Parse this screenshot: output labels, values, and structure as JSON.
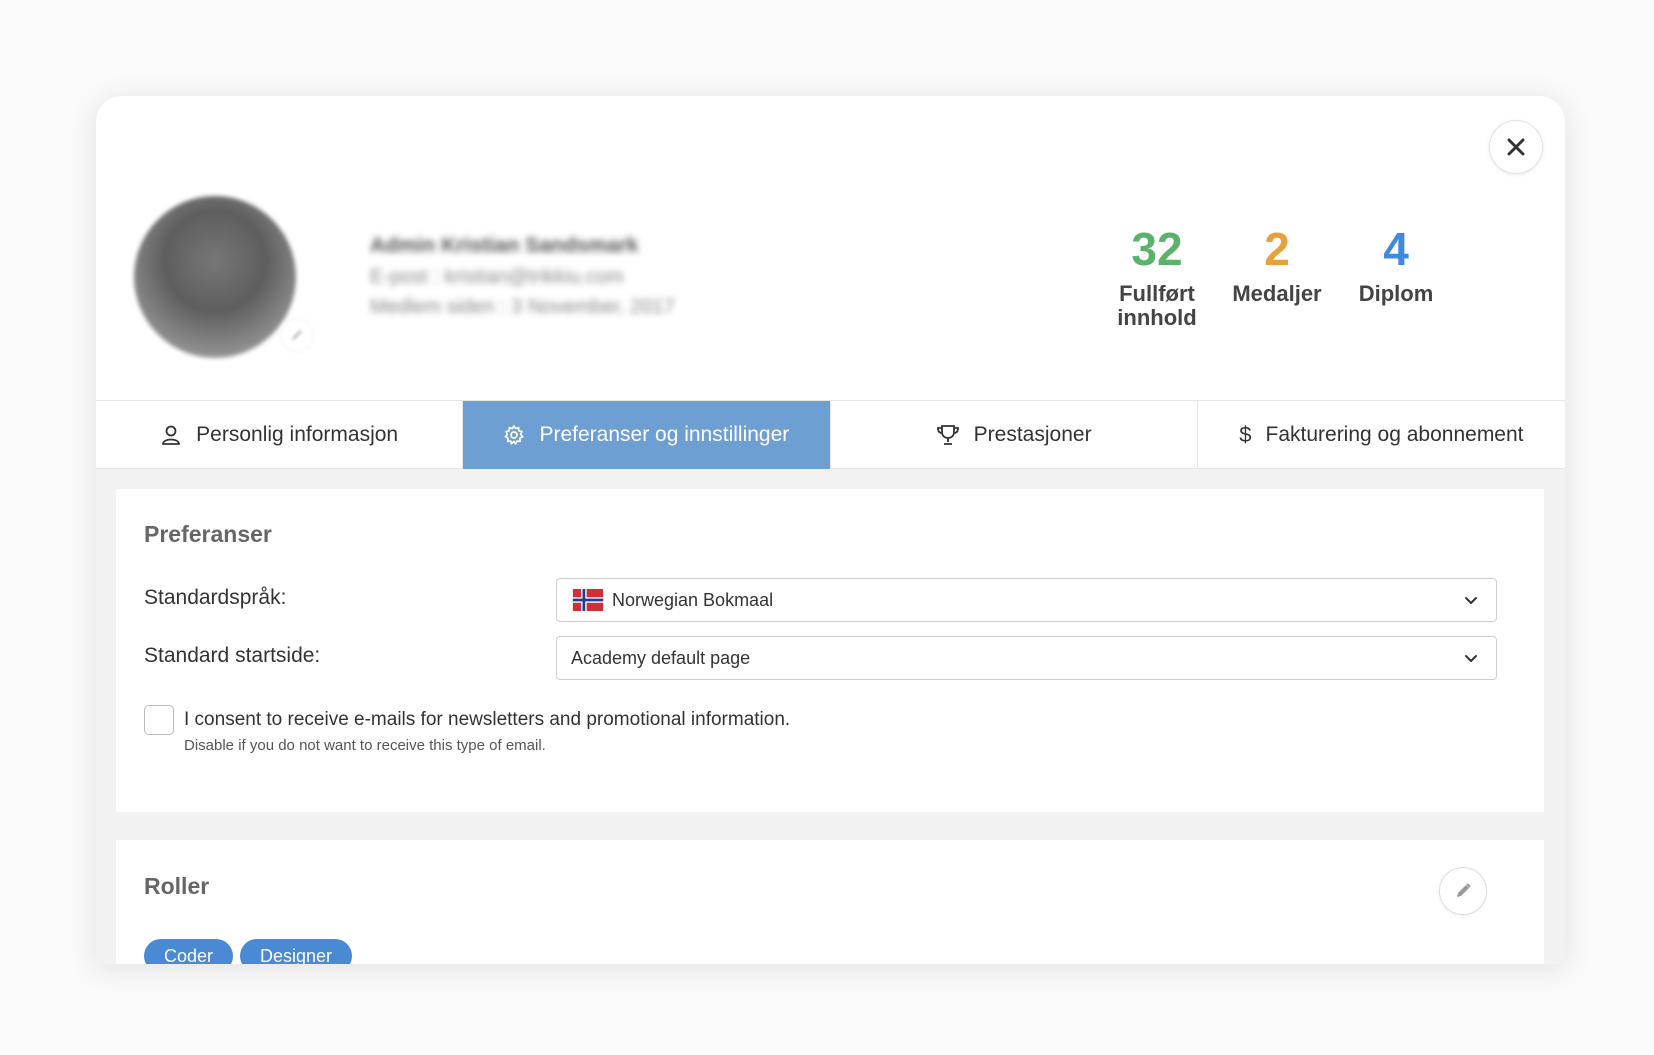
{
  "profile": {
    "name": "Admin Kristian Sandsmark",
    "email": "E-post : kristian@trikkiu.com",
    "member_since": "Medlem siden : 3 November, 2017"
  },
  "stats": [
    {
      "value": "32",
      "label_line1": "Fullført",
      "label_line2": "innhold",
      "color": "#5cb26b"
    },
    {
      "value": "2",
      "label_line1": "Medaljer",
      "label_line2": "",
      "color": "#e8a03a"
    },
    {
      "value": "4",
      "label_line1": "Diplom",
      "label_line2": "",
      "color": "#3f8ae0"
    }
  ],
  "tabs": [
    {
      "label": "Personlig informasjon",
      "icon": "user-icon",
      "active": false
    },
    {
      "label": "Preferanser og innstillinger",
      "icon": "gear-icon",
      "active": true
    },
    {
      "label": "Prestasjoner",
      "icon": "trophy-icon",
      "active": false
    },
    {
      "label": "Fakturering og abonnement",
      "icon": "dollar-icon",
      "active": false
    }
  ],
  "preferences": {
    "title": "Preferanser",
    "language_label": "Standardspråk:",
    "language_value": "Norwegian Bokmaal",
    "startpage_label": "Standard startside:",
    "startpage_value": "Academy default page",
    "consent_text": "I consent to receive e-mails for newsletters and promotional information.",
    "consent_sub": "Disable if you do not want to receive this type of email.",
    "consent_checked": false
  },
  "roles": {
    "title": "Roller",
    "tags": [
      "Coder",
      "Designer"
    ]
  },
  "colors": {
    "accent": "#6e9fd2",
    "tag": "#4a89d4"
  }
}
